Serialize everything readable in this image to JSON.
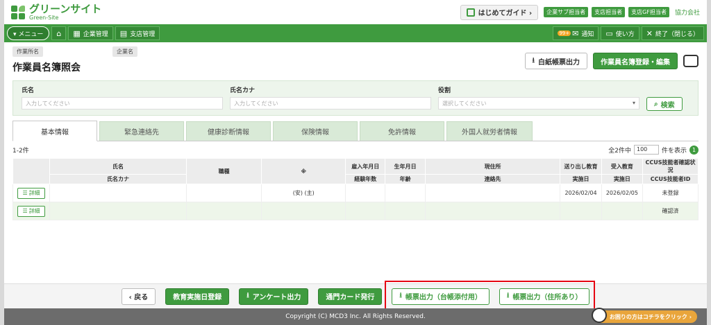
{
  "header": {
    "logo_jp": "グリーンサイト",
    "logo_en": "Green-Site",
    "guide_label": "はじめてガイド ›",
    "roles": [
      "企業サブ担当者",
      "支店担当者",
      "支店GF担当者"
    ],
    "company": "協力会社"
  },
  "nav": {
    "menu": "▾ メニュー",
    "company_mgmt": "企業管理",
    "branch_mgmt": "支店管理",
    "notice_badge": "99+",
    "notice": "通知",
    "howto": "使い方",
    "exit": "終了（閉じる）"
  },
  "page": {
    "tag_worksite": "作業所名",
    "tag_company": "企業名",
    "title": "作業員名簿照会",
    "blank_print": "白紙帳票出力",
    "register_edit": "作業員名簿登録・編集"
  },
  "search": {
    "name_label": "氏名",
    "name_placeholder": "入力してください",
    "kana_label": "氏名カナ",
    "kana_placeholder": "入力してください",
    "role_label": "役割",
    "role_placeholder": "選択してください",
    "search_btn": "検索"
  },
  "tabs": [
    "基本情報",
    "緊急連絡先",
    "健康診断情報",
    "保険情報",
    "免許情報",
    "外国人就労者情報"
  ],
  "results": {
    "count": "1-2件",
    "total": "全2件中",
    "per_page": "100",
    "suffix": "件を表示",
    "page": "1"
  },
  "table": {
    "h_name": "氏名",
    "h_kana": "氏名カナ",
    "h_job": "職種",
    "h_mark": "※",
    "h_hire": "雇入年月日",
    "h_exp": "経験年数",
    "h_birth": "生年月日",
    "h_age": "年齢",
    "h_addr": "現住所",
    "h_contact": "連絡先",
    "h_sendedu": "送り出し教育",
    "h_sendedu2": "実施日",
    "h_recvedu": "受入教育",
    "h_recvedu2": "実施日",
    "h_ccus": "CCUS技能者確認状況",
    "h_ccusid": "CCUS技能者ID",
    "detail": "詳細",
    "rows": [
      {
        "mark": "(安) (主)",
        "send": "2026/02/04",
        "recv": "2026/02/05",
        "ccus": "未登録"
      },
      {
        "mark": "",
        "send": "",
        "recv": "",
        "ccus": "確認済"
      }
    ]
  },
  "footer": {
    "back": "‹ 戻る",
    "edu_date": "教育実施日登録",
    "survey": "アンケート出力",
    "gate_card": "通門カード発行",
    "print_ledger": "帳票出力（台帳添付用）",
    "print_address": "帳票出力（住所あり）",
    "copyright": "Copyright (C) MCD3 Inc. All Rights Reserved.",
    "help": "お困りの方はコチラをクリック ›"
  }
}
